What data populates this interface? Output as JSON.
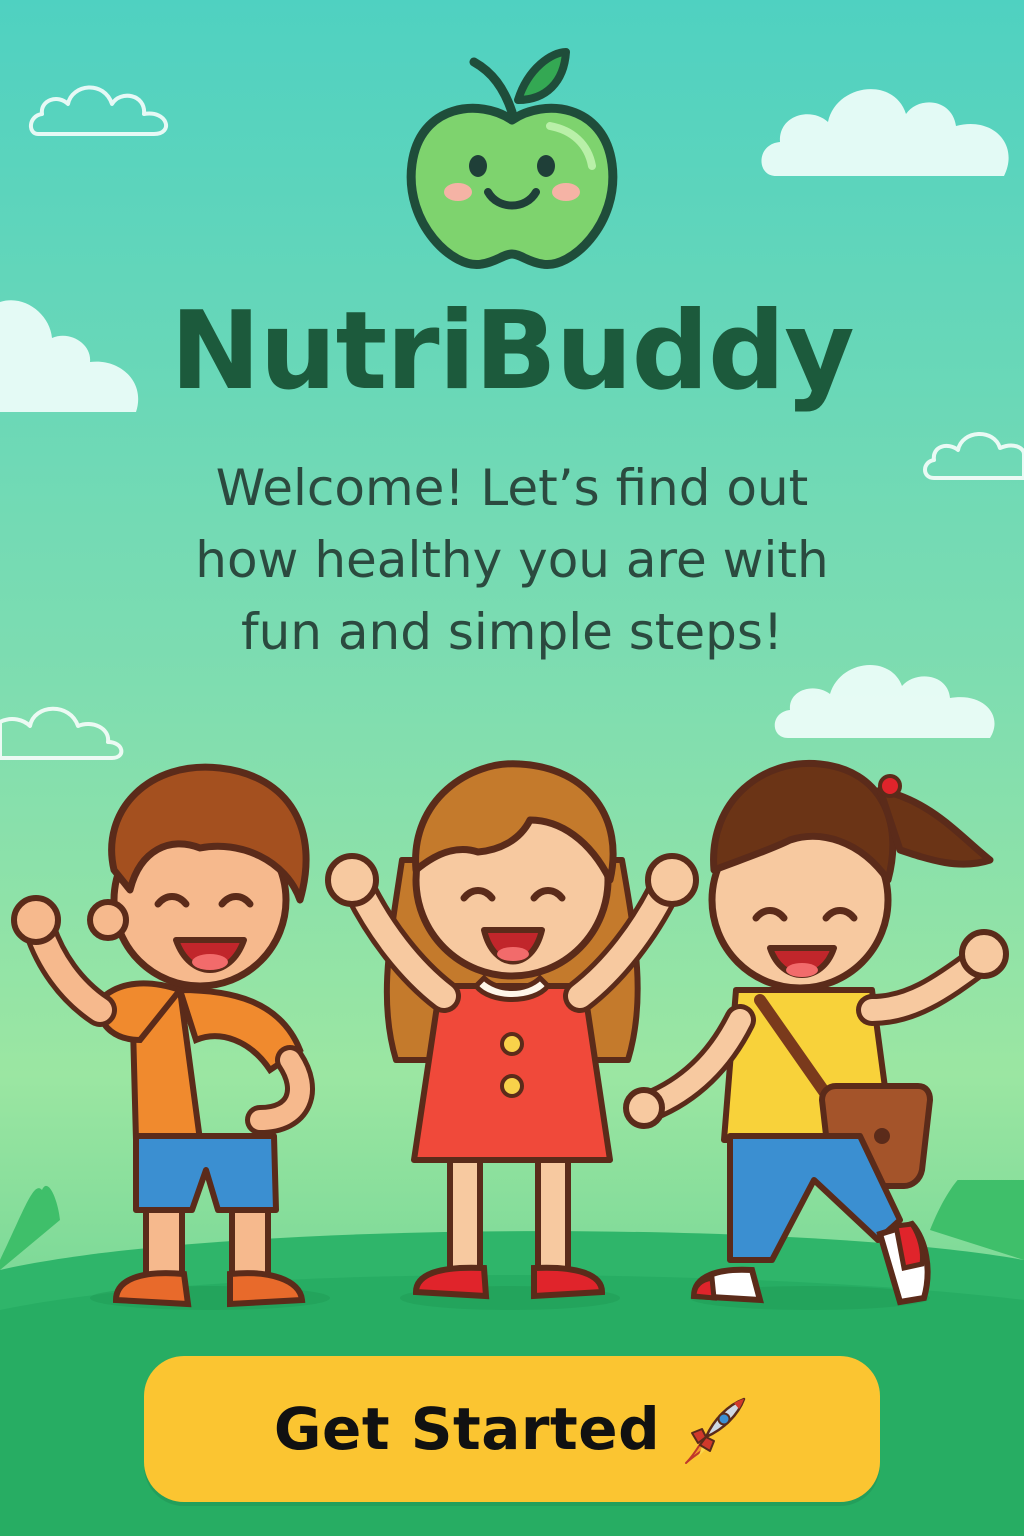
{
  "app": {
    "title": "NutriBuddy",
    "subtitle_lines": [
      "Welcome! Let’s find out",
      "how healthy you are with",
      "fun and simple steps!"
    ]
  },
  "cta": {
    "label": "Get Started",
    "icon": "rocket-icon"
  },
  "icons": {
    "logo": "apple-mascot-icon"
  },
  "colors": {
    "bg_top": "#4fd1c1",
    "bg_bottom": "#56c98a",
    "title": "#1c5a3c",
    "button": "#fbc531"
  }
}
